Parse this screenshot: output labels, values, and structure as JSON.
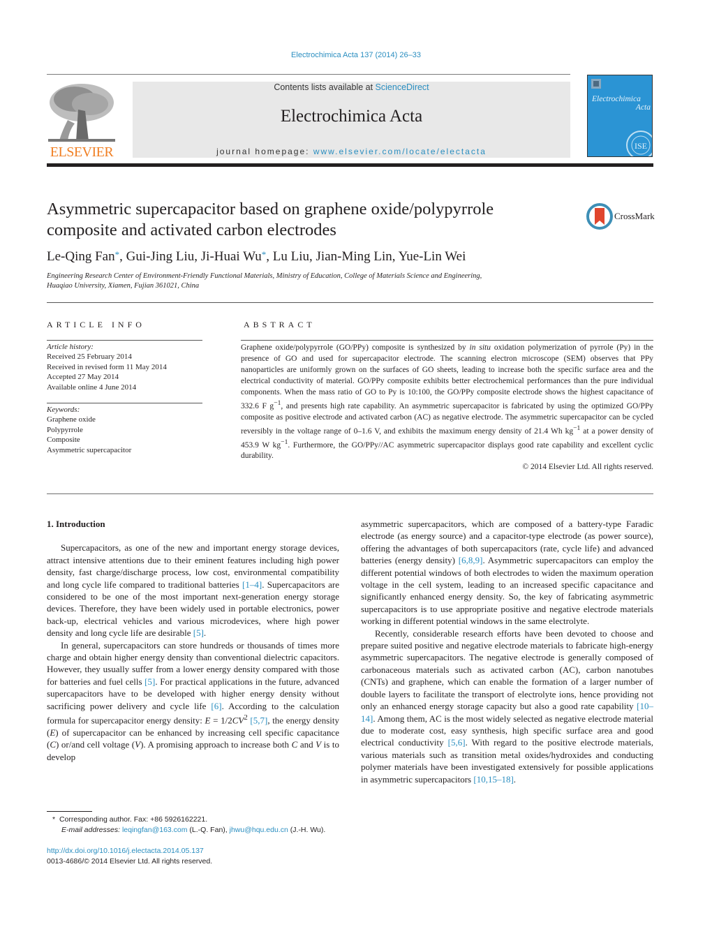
{
  "header": {
    "citation": "Electrochimica Acta 137 (2014) 26–33",
    "contents_prefix": "Contents lists available at ",
    "contents_link": "ScienceDirect",
    "journal_name": "Electrochimica Acta",
    "homepage_prefix": "journal homepage: ",
    "homepage_link": "www.elsevier.com/locate/electacta",
    "publisher_logo": "ELSEVIER",
    "cover_title_line1": "Electrochimica",
    "cover_title_line2": "Acta",
    "cover_color": "#2b94d4",
    "publisher_color": "#f07f23",
    "link_color": "#2a8ec0"
  },
  "article": {
    "title_line1": "Asymmetric supercapacitor based on graphene oxide/polypyrrole",
    "title_line2": "composite and activated carbon electrodes",
    "crossmark": "CrossMark",
    "authors": [
      {
        "name": "Le-Qing Fan",
        "corresponding": true
      },
      {
        "name": "Gui-Jing Liu",
        "corresponding": false
      },
      {
        "name": "Ji-Huai Wu",
        "corresponding": true
      },
      {
        "name": "Lu Liu",
        "corresponding": false
      },
      {
        "name": "Jian-Ming Lin",
        "corresponding": false
      },
      {
        "name": "Yue-Lin Wei",
        "corresponding": false
      }
    ],
    "author_sep": ", ",
    "star": "*",
    "affiliation_line1": "Engineering Research Center of Environment-Friendly Functional Materials, Ministry of Education, College of Materials Science and Engineering,",
    "affiliation_line2": "Huaqiao University, Xiamen, Fujian 361021, China"
  },
  "article_info": {
    "label": "ARTICLE INFO",
    "history_label": "Article history:",
    "history": [
      "Received 25 February 2014",
      "Received in revised form 11 May 2014",
      "Accepted 27 May 2014",
      "Available online 4 June 2014"
    ],
    "keywords_label": "Keywords:",
    "keywords": [
      "Graphene oxide",
      "Polypyrrole",
      "Composite",
      "Asymmetric supercapacitor"
    ]
  },
  "abstract": {
    "label": "ABSTRACT",
    "p1": "Graphene oxide/polypyrrole (GO/PPy) composite is synthesized by ",
    "p1_italic": "in situ",
    "p2": " oxidation polymerization of pyrrole (Py) in the presence of GO and used for supercapacitor electrode. The scanning electron microscope (SEM) observes that PPy nanoparticles are uniformly grown on the surfaces of GO sheets, leading to increase both the specific surface area and the electrical conductivity of material. GO/PPy composite exhibits better electrochemical performances than the pure individual components. When the mass ratio of GO to Py is 10:100, the GO/PPy composite electrode shows the highest capacitance of 332.6 F g",
    "p2_sup": "−1",
    "p3": ", and presents high rate capability. An asymmetric supercapacitor is fabricated by using the optimized GO/PPy composite as positive electrode and activated carbon (AC) as negative electrode. The asymmetric supercapacitor can be cycled reversibly in the voltage range of 0–1.6 V, and exhibits the maximum energy density of 21.4 Wh kg",
    "p3_sup": "−1",
    "p4": " at a power density of 453.9 W kg",
    "p4_sup": "−1",
    "p5": ". Furthermore, the GO/PPy//AC asymmetric supercapacitor displays good rate capability and excellent cyclic durability.",
    "copyright": "© 2014 Elsevier Ltd. All rights reserved."
  },
  "body": {
    "section_heading": "1.  Introduction",
    "left": {
      "p1a": "Supercapacitors, as one of the new and important energy storage devices, attract intensive attentions due to their eminent features including high power density, fast charge/discharge process, low cost, environmental compatibility and long cycle life compared to traditional batteries ",
      "p1_cite1": "[1–4]",
      "p1b": ". Supercapacitors are considered to be one of the most important next-generation energy storage devices. Therefore, they have been widely used in portable electronics, power back-up, electrical vehicles and various microdevices, where high power density and long cycle life are desirable ",
      "p1_cite2": "[5]",
      "p1c": ".",
      "p2a": "In general, supercapacitors can store hundreds or thousands of times more charge and obtain higher energy density than conventional dielectric capacitors. However, they usually suffer from a lower energy density compared with those for batteries and fuel cells ",
      "p2_cite1": "[5]",
      "p2b": ". For practical applications in the future, advanced supercapacitors have to be developed with higher energy density without sacrificing power delivery and cycle life ",
      "p2_cite2": "[6]",
      "p2c": ". According to the calculation formula for supercapacitor energy density: ",
      "p2_formula_E": "E",
      "p2_formula_mid": " = 1/2",
      "p2_formula_CV": "CV",
      "p2_formula_sup": "2",
      "p2_cite3": "[5,7]",
      "p2d": ", the energy density (",
      "p2_E": "E",
      "p2e": ") of supercapacitor can be enhanced by increasing cell specific capacitance (",
      "p2_C": "C",
      "p2f": ") or/and cell voltage (",
      "p2_V": "V",
      "p2g": "). A promising approach to increase both ",
      "p2_C2": "C",
      "p2h": " and ",
      "p2_V2": "V",
      "p2i": " is to develop"
    },
    "right": {
      "p1a": "asymmetric supercapacitors, which are composed of a battery-type Faradic electrode (as energy source) and a capacitor-type electrode (as power source), offering the advantages of both supercapacitors (rate, cycle life) and advanced batteries (energy density) ",
      "p1_cite1": "[6,8,9]",
      "p1b": ". Asymmetric supercapacitors can employ the different potential windows of both electrodes to widen the maximum operation voltage in the cell system, leading to an increased specific capacitance and significantly enhanced energy density. So, the key of fabricating asymmetric supercapacitors is to use appropriate positive and negative electrode materials working in different potential windows in the same electrolyte.",
      "p2a": "Recently, considerable research efforts have been devoted to choose and prepare suited positive and negative electrode materials to fabricate high-energy asymmetric supercapacitors. The negative electrode is generally composed of carbonaceous materials such as activated carbon (AC), carbon nanotubes (CNTs) and graphene, which can enable the formation of a larger number of double layers to facilitate the transport of electrolyte ions, hence providing not only an enhanced energy storage capacity but also a good rate capability ",
      "p2_cite1": "[10–14]",
      "p2b": ". Among them, AC is the most widely selected as negative electrode material due to moderate cost, easy synthesis, high specific surface area and good electrical conductivity ",
      "p2_cite2": "[5,6]",
      "p2c": ". With regard to the positive electrode materials, various materials such as transition metal oxides/hydroxides and conducting polymer materials have been investigated extensively for possible applications in asymmetric supercapacitors ",
      "p2_cite3": "[10,15–18]",
      "p2d": "."
    }
  },
  "footnotes": {
    "star": "*",
    "corresponding": "Corresponding author. Fax: +86 5926162221.",
    "email_label": "E-mail addresses:",
    "email1": "leqingfan@163.com",
    "email1_owner": " (L.-Q. Fan), ",
    "email2": "jhwu@hqu.edu.cn",
    "email2_owner": " (J.-H. Wu).",
    "doi": "http://dx.doi.org/10.1016/j.electacta.2014.05.137",
    "issn": "0013-4686/© 2014 Elsevier Ltd. All rights reserved."
  }
}
